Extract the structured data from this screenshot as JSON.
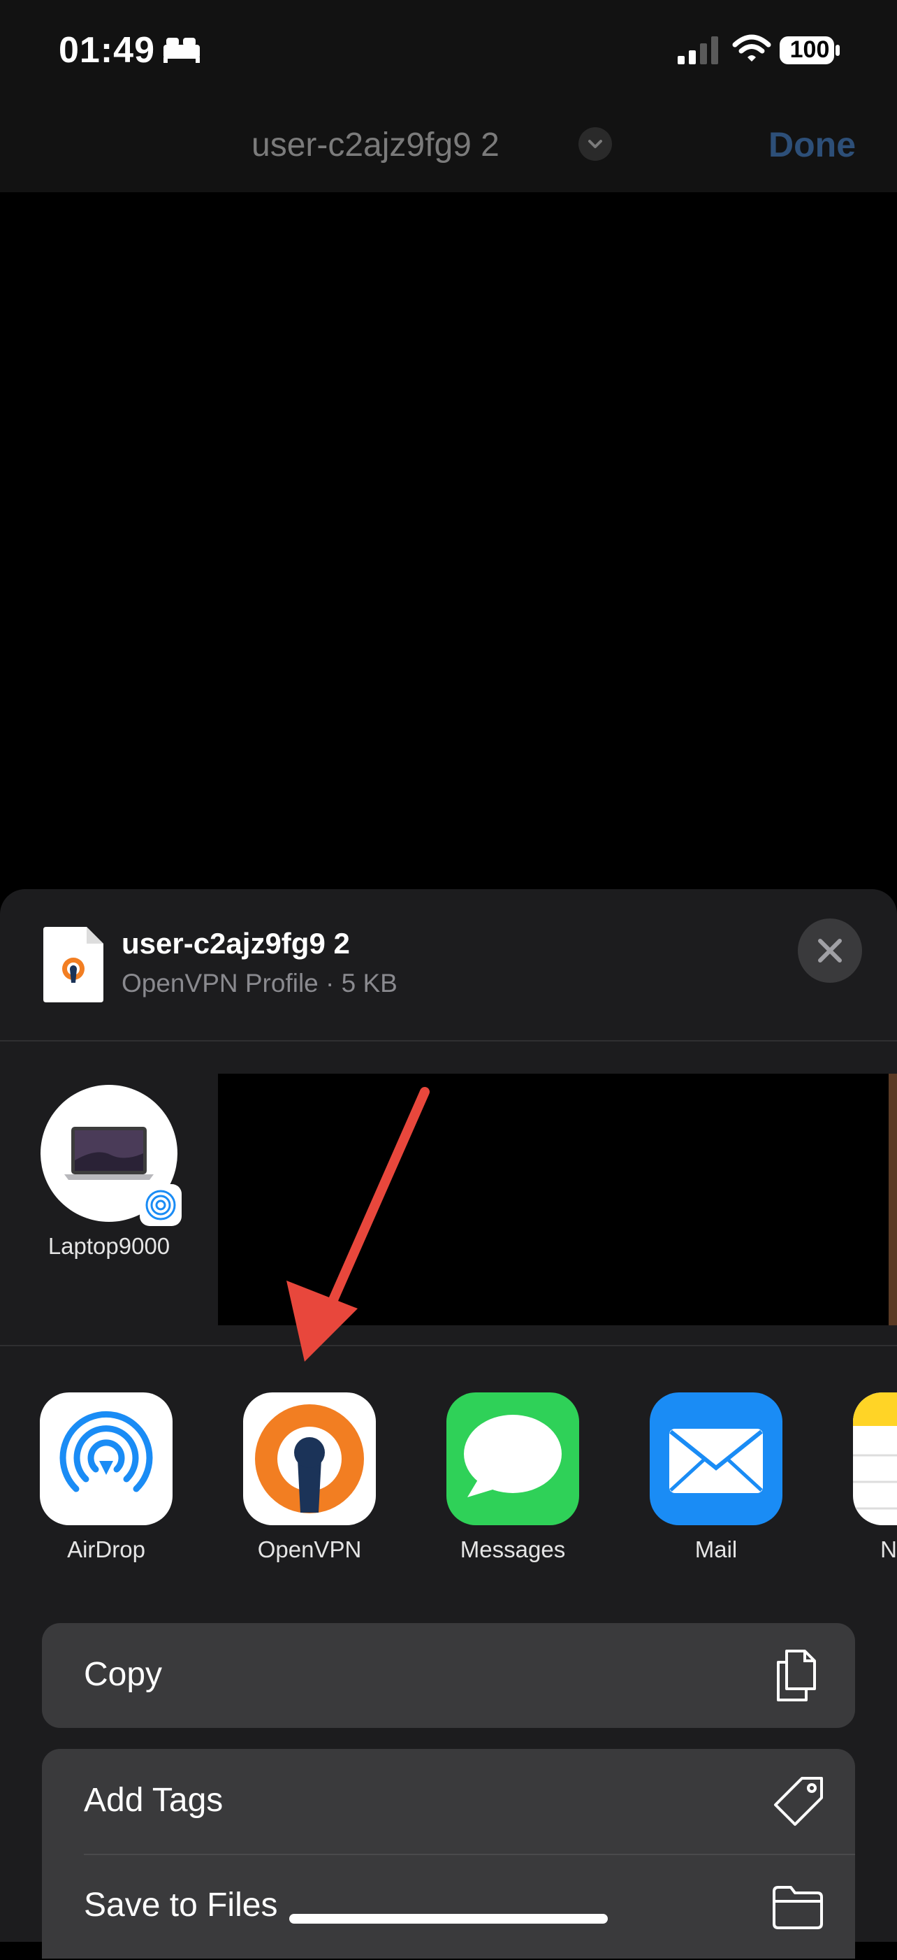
{
  "status_bar": {
    "time": "01:49",
    "battery": "100",
    "icons": [
      "sleep-focus-icon",
      "cellular-signal-icon",
      "wifi-icon",
      "battery-icon"
    ]
  },
  "nav": {
    "title": "user-c2ajz9fg9 2",
    "done_label": "Done",
    "chevron_icon": "chevron-down-icon"
  },
  "share_sheet": {
    "file": {
      "name": "user-c2ajz9fg9 2",
      "subtitle": "OpenVPN Profile · 5 KB",
      "icon": "openvpn-file-icon"
    },
    "close_icon": "close-icon",
    "people": [
      {
        "name": "Laptop9000",
        "badge_icon": "airdrop-icon"
      }
    ],
    "apps": [
      {
        "label": "AirDrop",
        "icon": "airdrop-icon"
      },
      {
        "label": "OpenVPN",
        "icon": "openvpn-icon"
      },
      {
        "label": "Messages",
        "icon": "messages-icon"
      },
      {
        "label": "Mail",
        "icon": "mail-icon"
      },
      {
        "label": "N",
        "icon": "notes-icon"
      }
    ],
    "actions": [
      {
        "label": "Copy",
        "icon": "copy-icon"
      },
      {
        "label": "Add Tags",
        "icon": "tag-icon"
      },
      {
        "label": "Save to Files",
        "icon": "folder-icon"
      }
    ]
  },
  "colors": {
    "accent_arrow": "#e8473c",
    "openvpn_orange": "#f27e22",
    "openvpn_navy": "#1b3358",
    "messages_green": "#2fd158",
    "mail_blue": "#1a8cf5",
    "sheet_bg": "#1c1c1e",
    "row_bg": "#3a3a3c"
  }
}
